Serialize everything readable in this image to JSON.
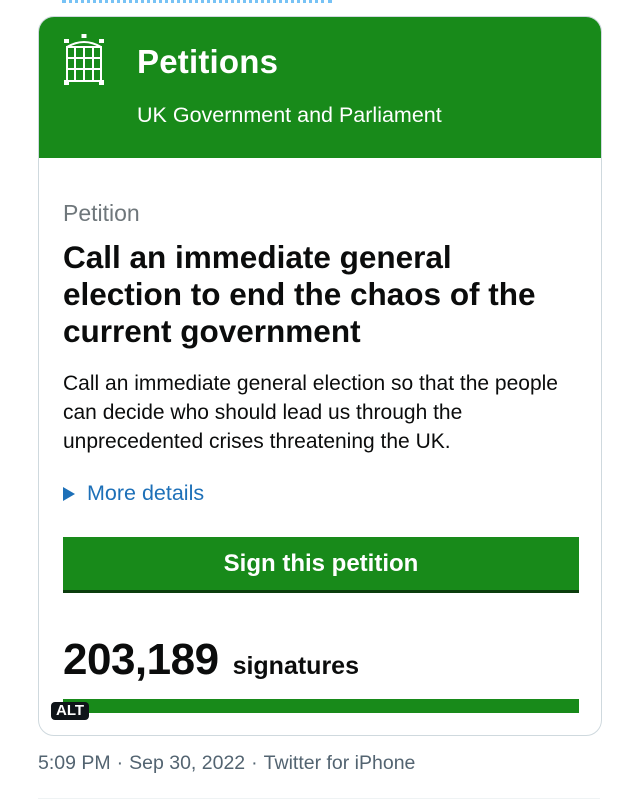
{
  "header": {
    "title": "Petitions",
    "subtitle": "UK Government and Parliament",
    "logo_icon": "portcullis-icon"
  },
  "petition": {
    "kind": "Petition",
    "title": "Call an immediate general election to end the chaos of the current government",
    "summary": "Call an immediate general election so that the people can decide who should lead us through the unprecedented crises threatening the UK.",
    "details_link": "More details",
    "sign_button": "Sign this petition",
    "signature_count": "203,189",
    "signature_label": "signatures",
    "progress_fraction": 1.0
  },
  "media": {
    "alt_badge": "ALT"
  },
  "tweet": {
    "time": "5:09 PM",
    "separator": "·",
    "date": "Sep 30, 2022",
    "source": "Twitter for iPhone"
  },
  "colors": {
    "brand_green": "#188a1a",
    "link_blue": "#1d70b8",
    "meta_gray": "#536471"
  }
}
